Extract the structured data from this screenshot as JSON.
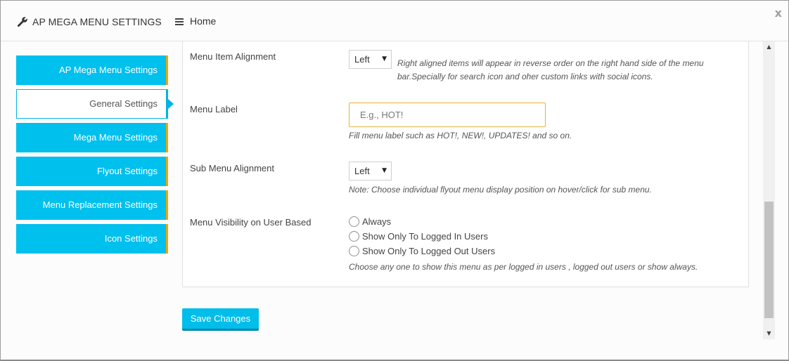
{
  "header": {
    "title": "AP MEGA MENU SETTINGS",
    "home_label": "Home",
    "close_label": "x"
  },
  "sidebar": {
    "items": [
      {
        "label": "AP Mega Menu Settings",
        "active": false
      },
      {
        "label": "General Settings",
        "active": true
      },
      {
        "label": "Mega Menu Settings",
        "active": false
      },
      {
        "label": "Flyout Settings",
        "active": false
      },
      {
        "label": "Menu Replacement Settings",
        "active": false
      },
      {
        "label": "Icon Settings",
        "active": false
      }
    ]
  },
  "form": {
    "menu_item_alignment": {
      "label": "Menu Item Alignment",
      "value": "Left",
      "hint_line1": "Right aligned items will appear in reverse order on the right hand side of the menu",
      "hint_line2": "bar.Specially for search icon and oher custom links with social icons."
    },
    "menu_label": {
      "label": "Menu Label",
      "placeholder": "E.g., HOT!",
      "value": "",
      "hint": "Fill menu label such as HOT!, NEW!, UPDATES! and so on."
    },
    "sub_menu_alignment": {
      "label": "Sub Menu Alignment",
      "value": "Left",
      "hint": "Note: Choose individual flyout menu display position on hover/click for sub menu."
    },
    "menu_visibility": {
      "label": "Menu Visibility on User Based",
      "options": [
        "Always",
        "Show Only To Logged In Users",
        "Show Only To Logged Out Users"
      ],
      "hint": "Choose any one to show this menu as per logged in users , logged out users or show always."
    }
  },
  "actions": {
    "save_label": "Save Changes"
  },
  "colors": {
    "accent": "#00c0ee",
    "sidebar_border": "#f0a500",
    "input_focus": "#e5b33c"
  }
}
